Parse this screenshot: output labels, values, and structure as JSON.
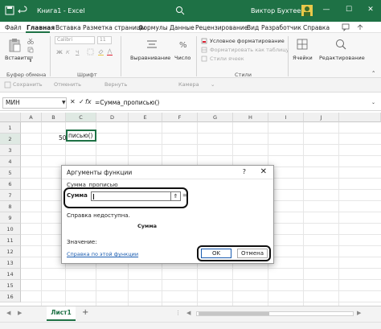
{
  "window": {
    "title": "Книга1  -  Excel",
    "user": "Виктор Бухтеев",
    "min": "—",
    "max": "☐",
    "close": "✕"
  },
  "menu": [
    "Файл",
    "Главная",
    "Вставка",
    "Разметка страницы",
    "Формулы",
    "Данные",
    "Рецензирование",
    "Вид",
    "Разработчик",
    "Справка"
  ],
  "ribbon": {
    "font_name": "Calibri",
    "font_size": "11",
    "paste": "Вставить",
    "align": "Выравнивание",
    "number": "Число",
    "cond_format": "Условное форматирование",
    "table_format": "Форматировать как таблицу",
    "cell_styles": "Стили ячеек",
    "cells": "Ячейки",
    "editing": "Редактирование",
    "groups": {
      "clipboard": "Буфер обмена",
      "font": "Шрифт",
      "styles": "Стили"
    }
  },
  "qat": {
    "save": "Сохранить",
    "undo": "Отменить",
    "redo": "Вернуть",
    "camera": "Камера"
  },
  "formula_bar": {
    "name_box": "МИН",
    "cancel": "✕",
    "enter": "✓",
    "fx": "fx",
    "formula": "=Сумма_прописью()"
  },
  "grid": {
    "columns": [
      "A",
      "B",
      "C",
      "D",
      "E",
      "F",
      "G",
      "H",
      "I",
      "J"
    ],
    "rows": [
      "1",
      "2",
      "3",
      "4",
      "5",
      "6",
      "7",
      "8",
      "9",
      "10",
      "11",
      "12",
      "13",
      "14",
      "15",
      "16"
    ],
    "b2_value": "50",
    "c2_value": "писью()"
  },
  "dialog": {
    "title": "Аргументы функции",
    "help_icon": "?",
    "close": "✕",
    "function_name": "Сумма_прописью",
    "arg_label": "Сумма",
    "arg_button": "⇑",
    "arg_equals": "=",
    "help_text": "Справка недоступна.",
    "arg_desc": "Сумма",
    "value_label": "Значение:",
    "help_link": "Справка по этой функции",
    "ok": "OK",
    "cancel": "Отмена"
  },
  "sheet": {
    "tab": "Лист1",
    "add": "+"
  },
  "colors": {
    "excel_green": "#1e7145",
    "link": "#1a5cb0"
  }
}
